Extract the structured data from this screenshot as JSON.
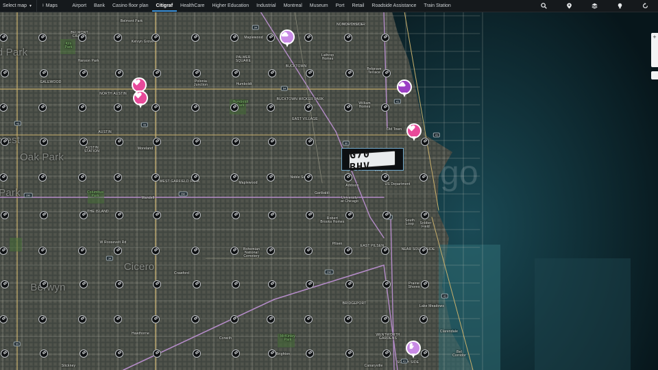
{
  "topbar": {
    "select_map": "Select map",
    "maps": "Maps",
    "tabs": [
      {
        "label": "Airport",
        "active": false
      },
      {
        "label": "Bank",
        "active": false
      },
      {
        "label": "Casino floor plan",
        "active": false
      },
      {
        "label": "Citigraf",
        "active": true
      },
      {
        "label": "HealthCare",
        "active": false
      },
      {
        "label": "Higher Education",
        "active": false
      },
      {
        "label": "Industrial",
        "active": false
      },
      {
        "label": "Montreal",
        "active": false
      },
      {
        "label": "Museum",
        "active": false
      },
      {
        "label": "Port",
        "active": false
      },
      {
        "label": "Retail",
        "active": false
      },
      {
        "label": "Roadside Assistance",
        "active": false
      },
      {
        "label": "Train Station",
        "active": false
      }
    ],
    "tools": [
      "search-icon",
      "location-pin-icon",
      "layers-icon",
      "bulb-icon",
      "reset-icon"
    ]
  },
  "colors": {
    "accent": "#3a8fd6",
    "poi_pink": "#e84a9a",
    "poi_purple": "#9b3fc4",
    "poi_lilac": "#c98be6",
    "lake": "#0f2a33"
  },
  "plate": {
    "text": "G70 BHV"
  },
  "labels": {
    "belmont_cragin": "BELMONT\nCRAGIN",
    "belmont_park": "Belmont Park",
    "kelvyn_grove": "Kelvyn Grove",
    "hanson_park": "Hanson Park",
    "kilbourn_park": "Kils\nPark",
    "galewood": "GALEWOOD",
    "north_austin": "NORTH AUSTIN",
    "austin": "AUSTIN",
    "oak_park": "Oak Park",
    "austin_station": "AUSTIN\nSTATION",
    "moreland": "Moreland",
    "mandell": "Mandell",
    "columbus_park": "Columbus\nPark",
    "the_island": "THE ISLAND",
    "cicero": "Cicero",
    "berwyn": "Berwyn",
    "crawford": "Crawford",
    "hawthorne": "Hawthorne",
    "corwith": "Corwith",
    "brighton": "Brighton",
    "mckinley_park": "McKinley\nPark",
    "bridgeport": "BRIDGEPORT",
    "wentworth_gardens": "WENTWORTH\nGARDENS",
    "south_side": "SOUTH SIDE",
    "canaryville": "Canaryville",
    "pilsen": "Pilsen",
    "bohemian_national": "Bohemian\nNational\nCemetery",
    "east_pilsen": "EAST PILSEN",
    "prairie_shores": "Prairie\nShores",
    "near_south_side": "NEAR SOUTH SIDE",
    "lake_meadows": "Lake Meadows",
    "clarendale": "Clarendale",
    "bel_corridor": "Bel\nCorridor",
    "soldier_field": "Soldier\nField",
    "us_department": "US Department",
    "maplewood": "Maplewood",
    "maplewood2": "Maplewood",
    "north_center": "NORTH CENTER",
    "palmer_square": "PALMER\nSQUARE",
    "humboldt": "Humboldt",
    "humboldt_park": "Humboldt\nPark",
    "bucktown": "BUCKTOWN",
    "bucktown_wicker": "BUCKTOWN WICKER PARK",
    "east_village": "EAST VILLAGE",
    "belgrave": "Belgrave\nTerrace",
    "william_homes": "William\nHomes",
    "old_town": "Old Town",
    "lathrop": "Lathrop\nHomes",
    "polonia": "Polonia\nJunction",
    "garibaldi": "Garibaldi",
    "chicago": "go",
    "noble_square": "Noble Square",
    "addison": "Addison",
    "west_garfield": "WEST GARFIELD PARK",
    "chicago_circle": "University\nat Chicago",
    "the_loop": "Loop",
    "brooks_homes": "Robert\nBrooks Homes",
    "south_loop": "South\nLoop",
    "near_north": "NORTHSIDE",
    "park_east": "Park",
    "forest": "orest",
    "park_w": "d Park",
    "park_w2": "Park",
    "stickney": "Stickney",
    "crawford_ave": "W Roosevelt Rd"
  },
  "shields": [
    "41",
    "94",
    "290",
    "290",
    "55",
    "90",
    "41",
    "41",
    "50",
    "43",
    "64",
    "43",
    "34",
    "290",
    "41"
  ]
}
